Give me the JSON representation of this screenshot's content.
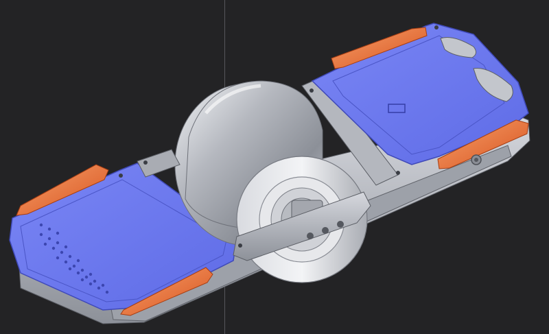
{
  "viewport": {
    "background": "#232325",
    "axis_line_color": "#56575c"
  },
  "model": {
    "subject": "onewheel-board-cad-render",
    "colors": {
      "footpad": "#6b78f0",
      "footpad_edge": "#4a56c8",
      "bumper": "#e0602e",
      "bumper_light": "#f08850",
      "rail": "#b9bcc4",
      "rail_dark": "#7f838c",
      "tire": "#a8abb2",
      "tire_highlight": "#e6e8ec",
      "hub": "#d2d4d8"
    }
  }
}
